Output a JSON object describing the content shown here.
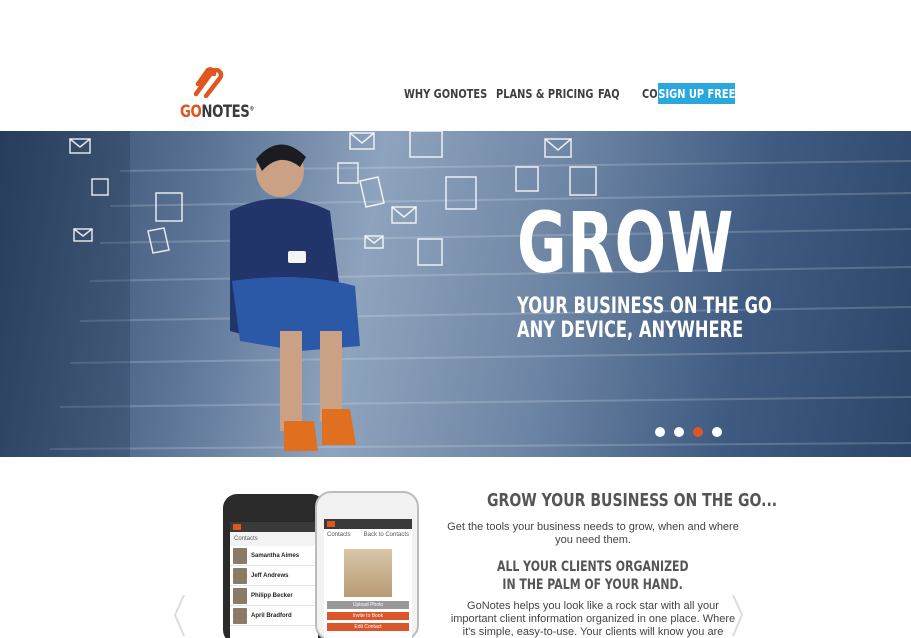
{
  "header": {
    "logo": {
      "go": "GO",
      "notes": "NOTES",
      "mark": "®"
    },
    "nav": [
      {
        "label": "WHY GONOTES"
      },
      {
        "label": "PLANS & PRICING"
      },
      {
        "label": "FAQ"
      },
      {
        "label": "COMMUNITY"
      }
    ],
    "signup_label": "SIGN UP FREE"
  },
  "hero": {
    "title": "GROW",
    "line1": "YOUR BUSINESS ON THE GO",
    "line2": "ANY DEVICE, ANYWHERE",
    "slide_count": 4,
    "active_slide": 3
  },
  "section": {
    "heading": "GROW YOUR BUSINESS ON THE GO...",
    "paragraph1": "Get the tools your business needs to grow, when and where you need them.",
    "subheading_line1": "ALL YOUR CLIENTS ORGANIZED",
    "subheading_line2": "IN THE PALM OF YOUR HAND.",
    "paragraph2": "GoNotes helps you look like a rock star with all your important client information organized in one place. Where it's simple, easy-to-use. Your clients will know you are"
  },
  "phones": {
    "back": {
      "header": "Contacts",
      "contacts": [
        "Samantha Aimes",
        "Jeff Andrews",
        "Philipp Becker",
        "April Bradford"
      ]
    },
    "front": {
      "header": "Contacts",
      "back_label": "Back to Contacts",
      "buttons": [
        "Upload Photo",
        "Invite to Book",
        "Edit Contact"
      ]
    }
  },
  "colors": {
    "accent": "#e0561f",
    "signup": "#29a8e0",
    "hero_text": "#ffffff"
  }
}
